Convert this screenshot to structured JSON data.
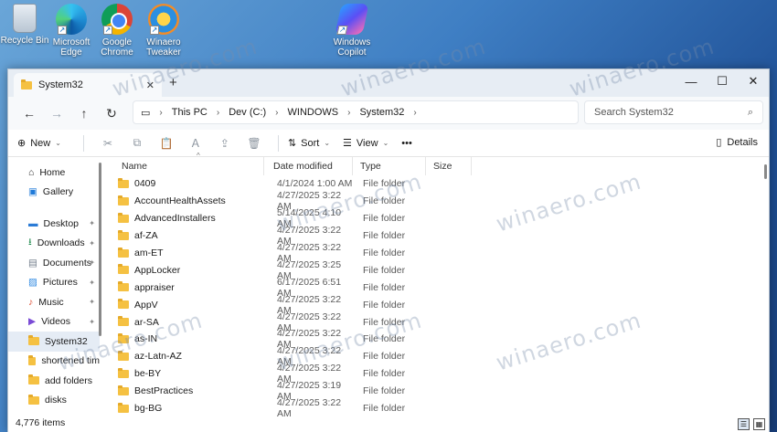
{
  "desktop": {
    "icons": [
      {
        "label": "Recycle Bin",
        "icon": "recycle-bin-icon"
      },
      {
        "label": "Microsoft Edge",
        "icon": "edge-icon"
      },
      {
        "label": "Google Chrome",
        "icon": "chrome-icon"
      },
      {
        "label": "Winaero Tweaker",
        "icon": "winaero-tweaker-icon"
      },
      {
        "label": "Windows Copilot",
        "icon": "copilot-icon"
      }
    ]
  },
  "window": {
    "tab_title": "System32",
    "new_tab": "+",
    "controls": {
      "minimize": "—",
      "maximize": "☐",
      "close": "✕"
    }
  },
  "address": {
    "crumbs": [
      "This PC",
      "Dev (C:)",
      "WINDOWS",
      "System32"
    ],
    "search_placeholder": "Search System32"
  },
  "toolbar": {
    "new_label": "New",
    "sort_label": "Sort",
    "view_label": "View",
    "more_label": "•••",
    "details_label": "Details"
  },
  "sidebar": {
    "top": [
      {
        "label": "Home",
        "icon": "home-icon"
      },
      {
        "label": "Gallery",
        "icon": "gallery-icon"
      }
    ],
    "pinned": [
      {
        "label": "Desktop",
        "icon": "desktop-icon"
      },
      {
        "label": "Downloads",
        "icon": "downloads-icon"
      },
      {
        "label": "Documents",
        "icon": "documents-icon"
      },
      {
        "label": "Pictures",
        "icon": "pictures-icon"
      },
      {
        "label": "Music",
        "icon": "music-icon"
      },
      {
        "label": "Videos",
        "icon": "videos-icon"
      }
    ],
    "folders": [
      {
        "label": "System32"
      },
      {
        "label": "shortened tim"
      },
      {
        "label": "add folders"
      },
      {
        "label": "disks"
      }
    ]
  },
  "columns": {
    "name": "Name",
    "date": "Date modified",
    "type": "Type",
    "size": "Size"
  },
  "rows": [
    {
      "name": "0409",
      "date": "4/1/2024 1:00 AM",
      "type": "File folder"
    },
    {
      "name": "AccountHealthAssets",
      "date": "4/27/2025 3:22 AM",
      "type": "File folder"
    },
    {
      "name": "AdvancedInstallers",
      "date": "5/14/2025 4:10 AM",
      "type": "File folder"
    },
    {
      "name": "af-ZA",
      "date": "4/27/2025 3:22 AM",
      "type": "File folder"
    },
    {
      "name": "am-ET",
      "date": "4/27/2025 3:22 AM",
      "type": "File folder"
    },
    {
      "name": "AppLocker",
      "date": "4/27/2025 3:25 AM",
      "type": "File folder"
    },
    {
      "name": "appraiser",
      "date": "6/17/2025 6:51 AM",
      "type": "File folder"
    },
    {
      "name": "AppV",
      "date": "4/27/2025 3:22 AM",
      "type": "File folder"
    },
    {
      "name": "ar-SA",
      "date": "4/27/2025 3:22 AM",
      "type": "File folder"
    },
    {
      "name": "as-IN",
      "date": "4/27/2025 3:22 AM",
      "type": "File folder"
    },
    {
      "name": "az-Latn-AZ",
      "date": "4/27/2025 3:22 AM",
      "type": "File folder"
    },
    {
      "name": "be-BY",
      "date": "4/27/2025 3:22 AM",
      "type": "File folder"
    },
    {
      "name": "BestPractices",
      "date": "4/27/2025 3:19 AM",
      "type": "File folder"
    },
    {
      "name": "bg-BG",
      "date": "4/27/2025 3:22 AM",
      "type": "File folder"
    }
  ],
  "status": {
    "item_count": "4,776 items"
  },
  "watermark": "winaero.com"
}
